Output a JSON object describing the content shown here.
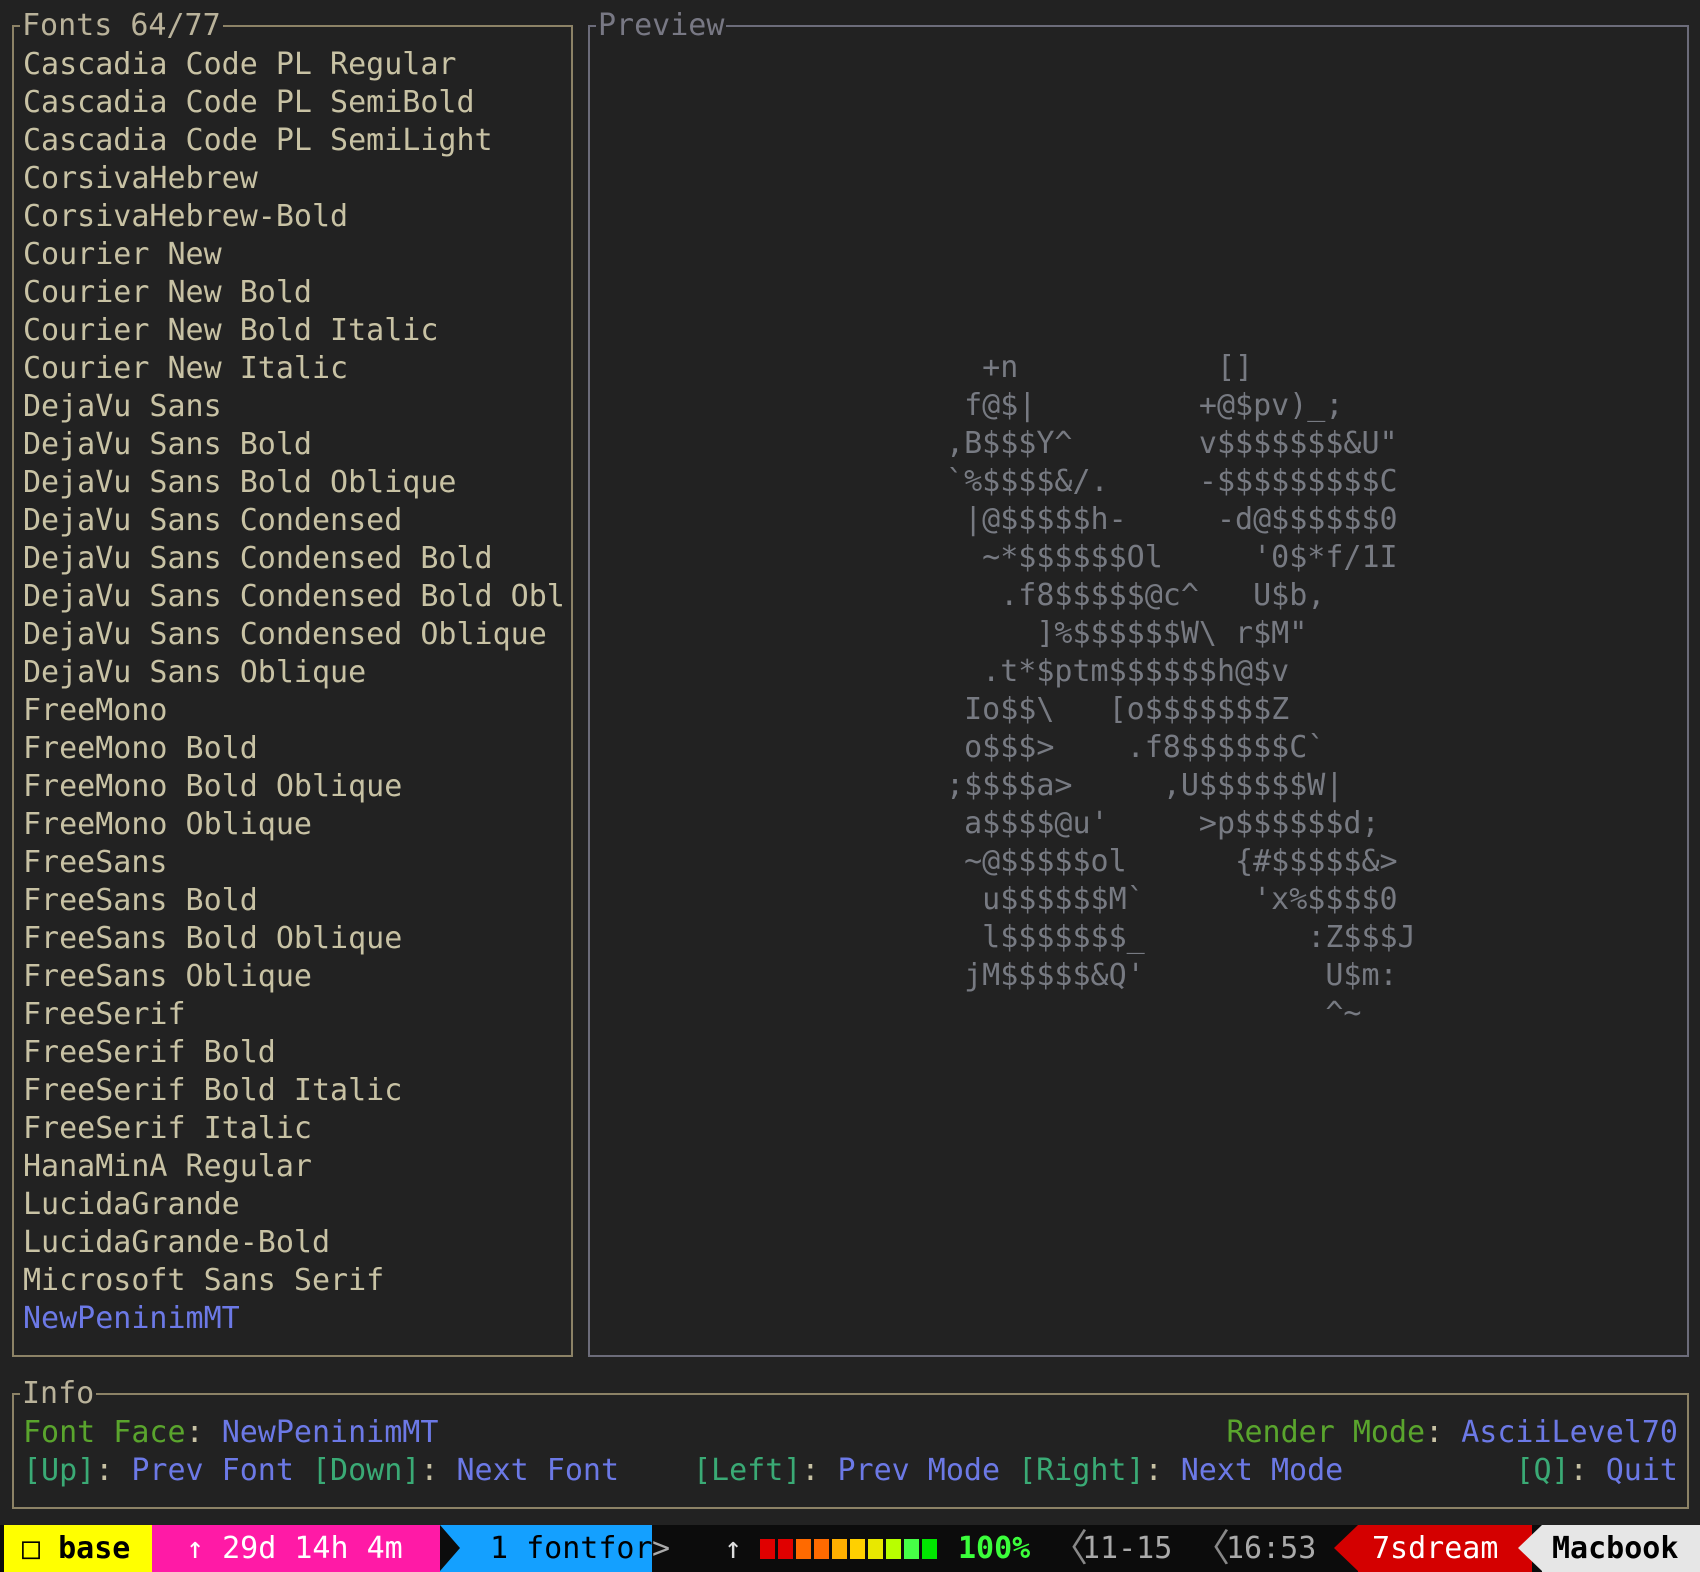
{
  "fonts_panel": {
    "title": "Fonts 64/77",
    "items": [
      "Cascadia Code PL Regular",
      "Cascadia Code PL SemiBold",
      "Cascadia Code PL SemiLight",
      "CorsivaHebrew",
      "CorsivaHebrew-Bold",
      "Courier New",
      "Courier New Bold",
      "Courier New Bold Italic",
      "Courier New Italic",
      "DejaVu Sans",
      "DejaVu Sans Bold",
      "DejaVu Sans Bold Oblique",
      "DejaVu Sans Condensed",
      "DejaVu Sans Condensed Bold",
      "DejaVu Sans Condensed Bold Obl",
      "DejaVu Sans Condensed Oblique",
      "DejaVu Sans Oblique",
      "FreeMono",
      "FreeMono Bold",
      "FreeMono Bold Oblique",
      "FreeMono Oblique",
      "FreeSans",
      "FreeSans Bold",
      "FreeSans Bold Oblique",
      "FreeSans Oblique",
      "FreeSerif",
      "FreeSerif Bold",
      "FreeSerif Bold Italic",
      "FreeSerif Italic",
      "HanaMinA Regular",
      "LucidaGrande",
      "LucidaGrande-Bold",
      "Microsoft Sans Serif",
      "NewPeninimMT"
    ],
    "selected": "NewPeninimMT"
  },
  "preview_panel": {
    "title": "Preview",
    "ascii_art": "   +n           []\n  f@$|         +@$pv)_;\n ,B$$$Y^       v$$$$$$$&U\"\n `%$$$$&/.     -$$$$$$$$$C\n  |@$$$$$h-     -d@$$$$$$0\n   ~*$$$$$$Ol     '0$*f/1I\n    .f8$$$$$@c^   U$b,\n      ]%$$$$$$W\\ r$M\"\n   .t*$ptm$$$$$$h@$v\n  Io$$\\   [o$$$$$$$Z\n  o$$$>    .f8$$$$$$C`\n ;$$$$a>     ,U$$$$$$W|\n  a$$$$@u'     >p$$$$$$d;\n  ~@$$$$$ol      {#$$$$$&>\n   u$$$$$$M`      'x%$$$$0\n   l$$$$$$$_         :Z$$$J\n  jM$$$$$&Q'          U$m:\n                      ^~"
  },
  "info_panel": {
    "title": "Info",
    "font_face_label": "Font Face",
    "font_face_value": "NewPeninimMT",
    "render_mode_label": "Render Mode",
    "render_mode_value": "AsciiLevel70",
    "separator": ": ",
    "keys": {
      "up": "[Up]",
      "up_action": "Prev Font",
      "down": "[Down]",
      "down_action": "Next Font",
      "left": "[Left]",
      "left_action": "Prev Mode",
      "right": "[Right]",
      "right_action": "Next Mode",
      "quit": "[Q]",
      "quit_action": "Quit"
    }
  },
  "status_bar": {
    "session": "□ base",
    "uptime": "↑ 29d 14h 4m",
    "window": "1 fontfor",
    "battery_icon": "↑",
    "battery_percent": "100%",
    "date": "11-15",
    "time": "16:53",
    "user": "7sdream",
    "host": "Macbook",
    "battery_level": 1.0,
    "colors": {
      "session_bg": "#ffff00",
      "uptime_bg": "#ff1aa6",
      "window_bg": "#14a0ff",
      "user_bg": "#d40000",
      "host_bg": "#e6e6e6",
      "battery_text": "#3bff3b"
    }
  }
}
